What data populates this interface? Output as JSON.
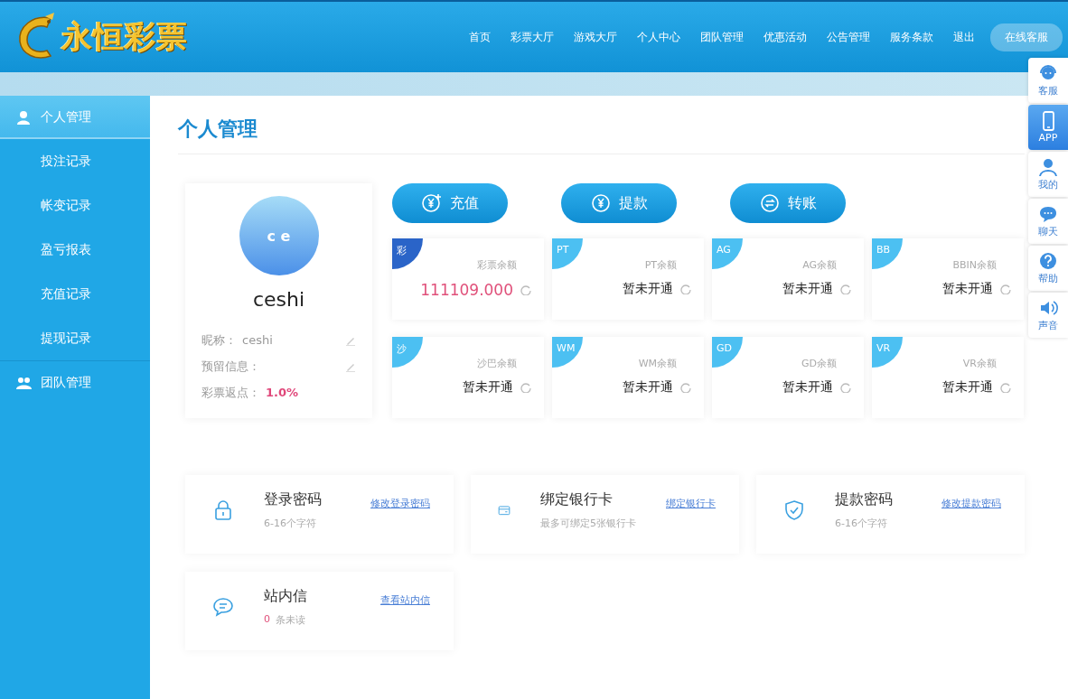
{
  "header": {
    "logo_text": "永恒彩票",
    "nav": [
      {
        "label": "首页"
      },
      {
        "label": "彩票大厅"
      },
      {
        "label": "游戏大厅"
      },
      {
        "label": "个人中心"
      },
      {
        "label": "团队管理"
      },
      {
        "label": "优惠活动"
      },
      {
        "label": "公告管理"
      },
      {
        "label": "服务条款"
      },
      {
        "label": "退出"
      }
    ],
    "service_button": "在线客服"
  },
  "sidebar": {
    "items": [
      {
        "label": "个人管理",
        "kind": "person",
        "selected": true,
        "children": [
          {
            "label": "投注记录",
            "selected": false
          },
          {
            "label": "帐变记录",
            "selected": false
          },
          {
            "label": "盈亏报表",
            "selected": false
          },
          {
            "label": "充值记录",
            "selected": false
          },
          {
            "label": "提现记录",
            "selected": false
          }
        ]
      },
      {
        "label": "团队管理",
        "kind": "team",
        "selected": false
      }
    ]
  },
  "page_title": "个人管理",
  "profile": {
    "avatar_text": "c e",
    "username": "ceshi",
    "fields": [
      {
        "label": "昵称：",
        "value": "ceshi",
        "editable": true
      },
      {
        "label": "预留信息：",
        "editable": true
      },
      {
        "label": "彩票返点：",
        "value": "1.0%",
        "highlight": true,
        "editable": false
      }
    ]
  },
  "actions": [
    {
      "label": "充值",
      "kind": "deposit"
    },
    {
      "label": "提款",
      "kind": "withdraw"
    },
    {
      "label": "转账",
      "kind": "transfer"
    }
  ],
  "balances": [
    {
      "badge": "彩",
      "title": "彩票余额",
      "value": "111109.000",
      "active": true,
      "color": "#2a64c8"
    },
    {
      "badge": "PT",
      "title": "PT余额",
      "value": "暂未开通",
      "active": false,
      "color": "#4cc0f2"
    },
    {
      "badge": "AG",
      "title": "AG余额",
      "value": "暂未开通",
      "active": false,
      "color": "#4cc0f2"
    },
    {
      "badge": "BB",
      "title": "BBIN余额",
      "value": "暂未开通",
      "active": false,
      "color": "#4cc0f2"
    },
    {
      "badge": "沙",
      "title": "沙巴余额",
      "value": "暂未开通",
      "active": false,
      "color": "#4cc0f2"
    },
    {
      "badge": "WM",
      "title": "WM余额",
      "value": "暂未开通",
      "active": false,
      "color": "#4cc0f2"
    },
    {
      "badge": "GD",
      "title": "GD余额",
      "value": "暂未开通",
      "active": false,
      "color": "#4cc0f2"
    },
    {
      "badge": "VR",
      "title": "VR余额",
      "value": "暂未开通",
      "active": false,
      "color": "#4cc0f2"
    }
  ],
  "security": [
    {
      "kind": "lock",
      "title": "登录密码",
      "link": "修改登录密码",
      "note": "6-16个字符"
    },
    {
      "kind": "card",
      "title": "绑定银行卡",
      "link": "绑定银行卡",
      "note": "最多可绑定5张银行卡"
    },
    {
      "kind": "shield",
      "title": "提款密码",
      "link": "修改提款密码",
      "note": "6-16个字符"
    },
    {
      "kind": "message",
      "title": "站内信",
      "link": "查看站内信",
      "count": "0",
      "note": "条未读"
    }
  ],
  "float_menu": [
    {
      "label": "客服",
      "kind": "service",
      "selected": false
    },
    {
      "label": "APP",
      "kind": "phone",
      "selected": true
    },
    {
      "label": "我的",
      "kind": "user",
      "selected": false
    },
    {
      "label": "聊天",
      "kind": "chat",
      "selected": false
    },
    {
      "label": "帮助",
      "kind": "help",
      "selected": false
    },
    {
      "label": "声音",
      "kind": "sound",
      "selected": false
    }
  ]
}
